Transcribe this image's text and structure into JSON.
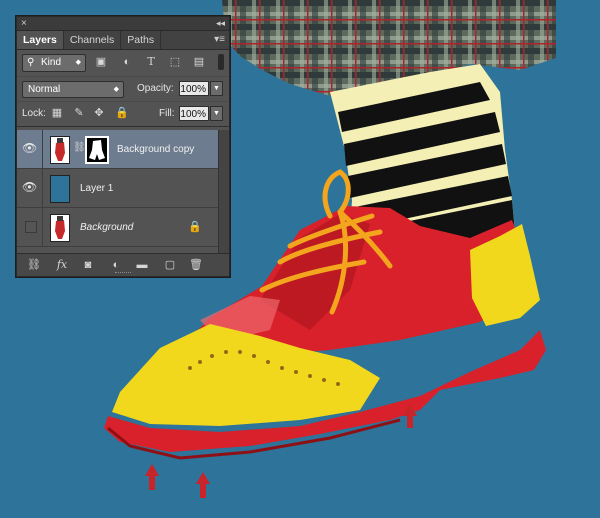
{
  "panel": {
    "close_glyph": "×",
    "collapse_glyph": "◂◂",
    "tabs": [
      {
        "label": "Layers",
        "active": true
      },
      {
        "label": "Channels",
        "active": false
      },
      {
        "label": "Paths",
        "active": false
      }
    ],
    "tab_menu_glyph": "▾≡",
    "filter": {
      "kind_label": "Kind",
      "icons": [
        "image-filter-icon",
        "adjustment-filter-icon",
        "type-filter-icon",
        "shape-filter-icon",
        "smart-object-filter-icon"
      ]
    },
    "blend_mode": "Normal",
    "opacity_label": "Opacity:",
    "opacity_value": "100%",
    "lock_label": "Lock:",
    "fill_label": "Fill:",
    "fill_value": "100%",
    "layers": [
      {
        "name": "Background copy",
        "visible": true,
        "selected": true,
        "has_mask": true,
        "italic": false,
        "locked": false
      },
      {
        "name": "Layer 1",
        "visible": true,
        "selected": false,
        "has_mask": false,
        "italic": false,
        "locked": false,
        "thumb_color": "#2e7399"
      },
      {
        "name": "Background",
        "visible": false,
        "selected": false,
        "has_mask": false,
        "italic": true,
        "locked": true
      }
    ],
    "footer_icons": [
      "link-layers-icon",
      "fx-icon",
      "add-mask-icon",
      "adjustment-layer-icon",
      "new-group-icon",
      "new-layer-icon",
      "trash-icon"
    ],
    "fx_text": "fx"
  },
  "colors": {
    "background": "#2e7399",
    "panel": "#535353",
    "selection": "#6e7c8f",
    "shoe_red": "#d8212a",
    "shoe_yellow": "#f2d81d",
    "lace": "#f2a51d",
    "arrow_red": "#c8242a"
  }
}
